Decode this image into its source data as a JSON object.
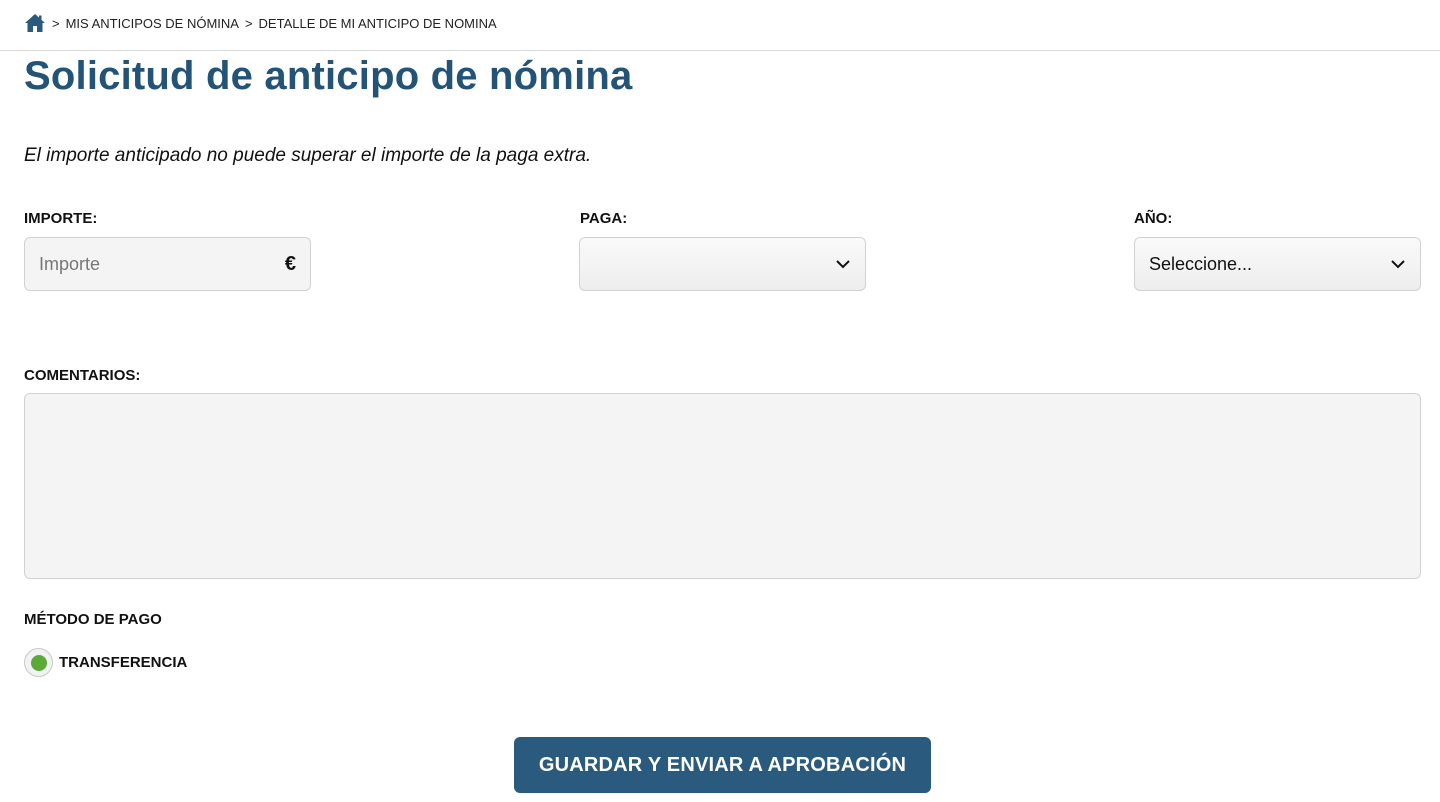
{
  "breadcrumb": {
    "items": [
      "MIS ANTICIPOS DE NÓMINA",
      "DETALLE DE MI ANTICIPO DE NOMINA"
    ],
    "separator": ">",
    "home_icon": "home-icon"
  },
  "page": {
    "title": "Solicitud de anticipo de nómina",
    "notice": "El importe anticipado no puede superar el importe de la paga extra."
  },
  "form": {
    "importe": {
      "label": "IMPORTE:",
      "placeholder": "Importe",
      "currency": "€"
    },
    "paga": {
      "label": "PAGA:",
      "value": ""
    },
    "anio": {
      "label": "AÑO:",
      "value": "Seleccione..."
    },
    "comentarios": {
      "label": "COMENTARIOS:",
      "value": ""
    },
    "metodo_pago": {
      "label": "MÉTODO DE PAGO",
      "options": [
        {
          "label": "TRANSFERENCIA",
          "selected": true
        }
      ]
    },
    "submit_label": "GUARDAR Y ENVIAR A APROBACIÓN"
  },
  "colors": {
    "title": "#235478",
    "button_bg": "#2a5a7e",
    "radio_selected": "#5aaa3a"
  }
}
